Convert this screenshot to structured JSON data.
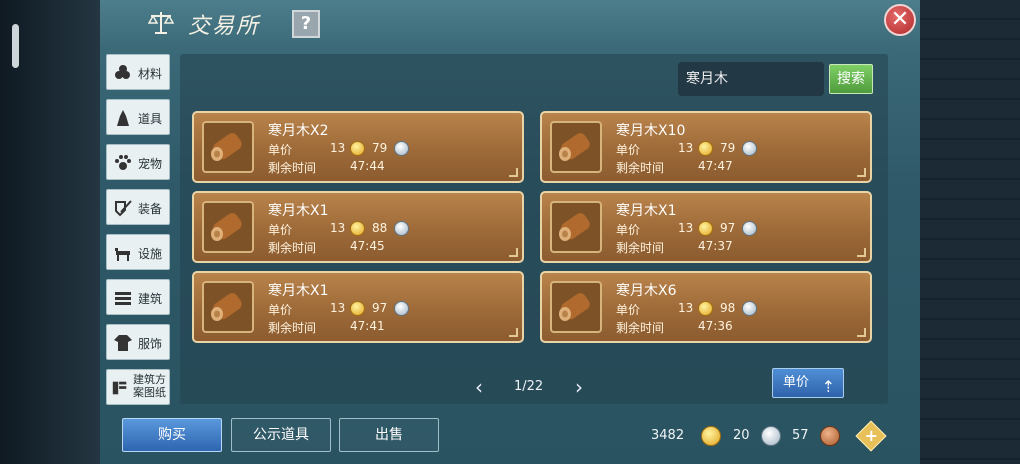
{
  "header": {
    "title": "交易所",
    "help": "?",
    "close": "✕"
  },
  "sidebar": {
    "items": [
      {
        "label": "材料",
        "icon": "materials-icon"
      },
      {
        "label": "道具",
        "icon": "props-icon"
      },
      {
        "label": "宠物",
        "icon": "pet-paw-icon"
      },
      {
        "label": "装备",
        "icon": "equipment-icon"
      },
      {
        "label": "设施",
        "icon": "facility-icon"
      },
      {
        "label": "建筑",
        "icon": "building-icon"
      },
      {
        "label": "服饰",
        "icon": "clothing-icon"
      },
      {
        "label": "建筑方案图纸",
        "icon": "blueprint-icon"
      }
    ]
  },
  "search": {
    "value": "寒月木",
    "button": "搜索"
  },
  "listing_labels": {
    "price": "单价",
    "time_left": "剩余时间"
  },
  "listings": [
    {
      "name": "寒月木X2",
      "gold": "13",
      "silver": "79",
      "time": "47:44"
    },
    {
      "name": "寒月木X10",
      "gold": "13",
      "silver": "79",
      "time": "47:47"
    },
    {
      "name": "寒月木X1",
      "gold": "13",
      "silver": "88",
      "time": "47:45"
    },
    {
      "name": "寒月木X1",
      "gold": "13",
      "silver": "97",
      "time": "47:37"
    },
    {
      "name": "寒月木X1",
      "gold": "13",
      "silver": "97",
      "time": "47:41"
    },
    {
      "name": "寒月木X6",
      "gold": "13",
      "silver": "98",
      "time": "47:36"
    }
  ],
  "pager": {
    "text": "1/22",
    "prev": "‹",
    "next": "›"
  },
  "sort": {
    "label": "单价",
    "arrow": "⇡"
  },
  "footer": {
    "buy": "购买",
    "public": "公示道具",
    "sell": "出售"
  },
  "currency": {
    "gold": "3482",
    "silver": "20",
    "copper": "57",
    "add": "+"
  },
  "colors": {
    "accent_green": "#5aab45",
    "accent_blue": "#3b78c3",
    "card_brown": "#9d6a38",
    "gold": "#e0a41f"
  }
}
